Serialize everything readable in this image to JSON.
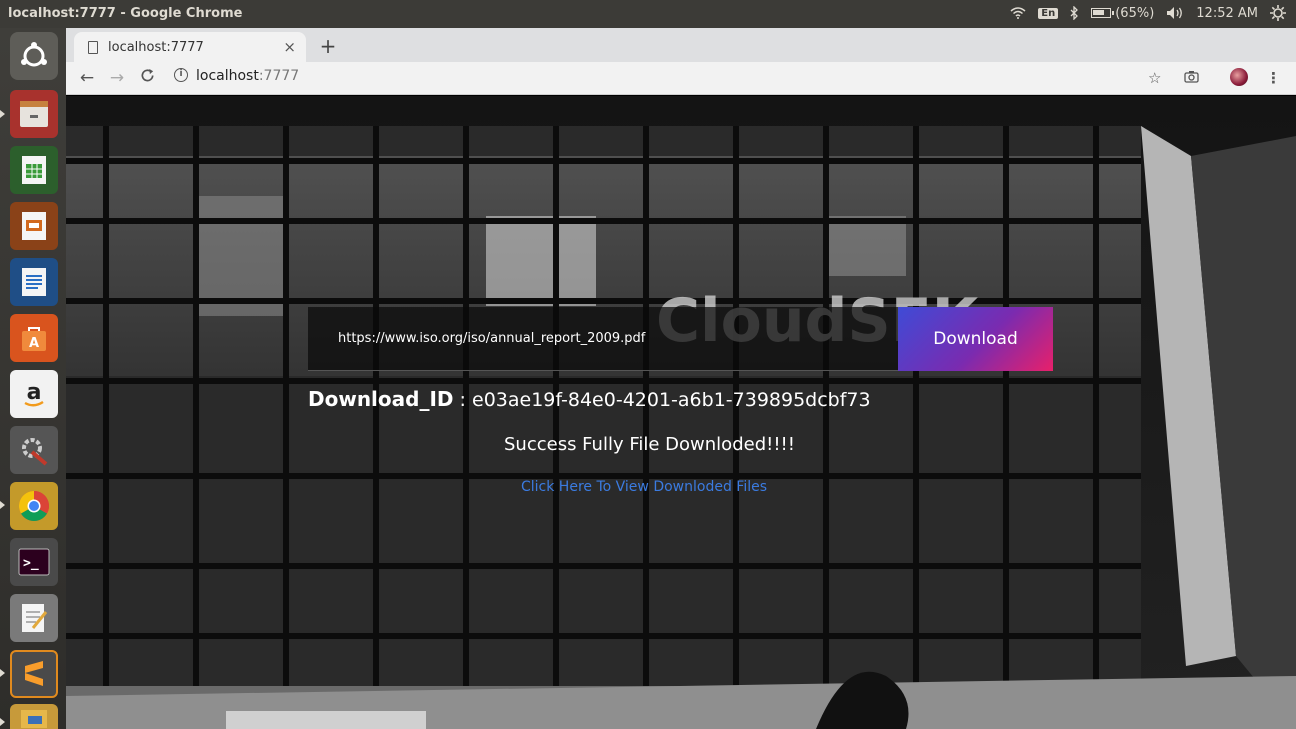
{
  "top_panel": {
    "window_title": "localhost:7777 - Google Chrome",
    "keyboard_layout": "En",
    "battery": "(65%)",
    "clock": "12:52 AM"
  },
  "launcher": {
    "items": [
      "ubuntu-dash",
      "files",
      "libreoffice-calc",
      "libreoffice-impress",
      "libreoffice-writer",
      "ubuntu-software",
      "amazon",
      "system-settings",
      "chrome",
      "terminal",
      "text-editor",
      "sublime-text",
      "file-manager"
    ]
  },
  "browser": {
    "tab_title": "localhost:7777",
    "new_tab": "+",
    "tab_close": "×",
    "address_host": "localhost",
    "address_port": ":7777"
  },
  "page": {
    "url_value": "https://www.iso.org/iso/annual_report_2009.pdf",
    "download_button": "Download",
    "download_id_label": "Download_ID",
    "download_id_sep": " : ",
    "download_id_value": "e03ae19f-84e0-4201-a6b1-739895dcbf73",
    "success_message": "Success Fully File Downloded!!!!",
    "view_link": "Click Here To View Downloded Files",
    "background_sign": "CloudSEK"
  },
  "colors": {
    "link": "#3b7be0",
    "button_gradient_start": "#3f4bd6",
    "button_gradient_end": "#e8206a"
  }
}
